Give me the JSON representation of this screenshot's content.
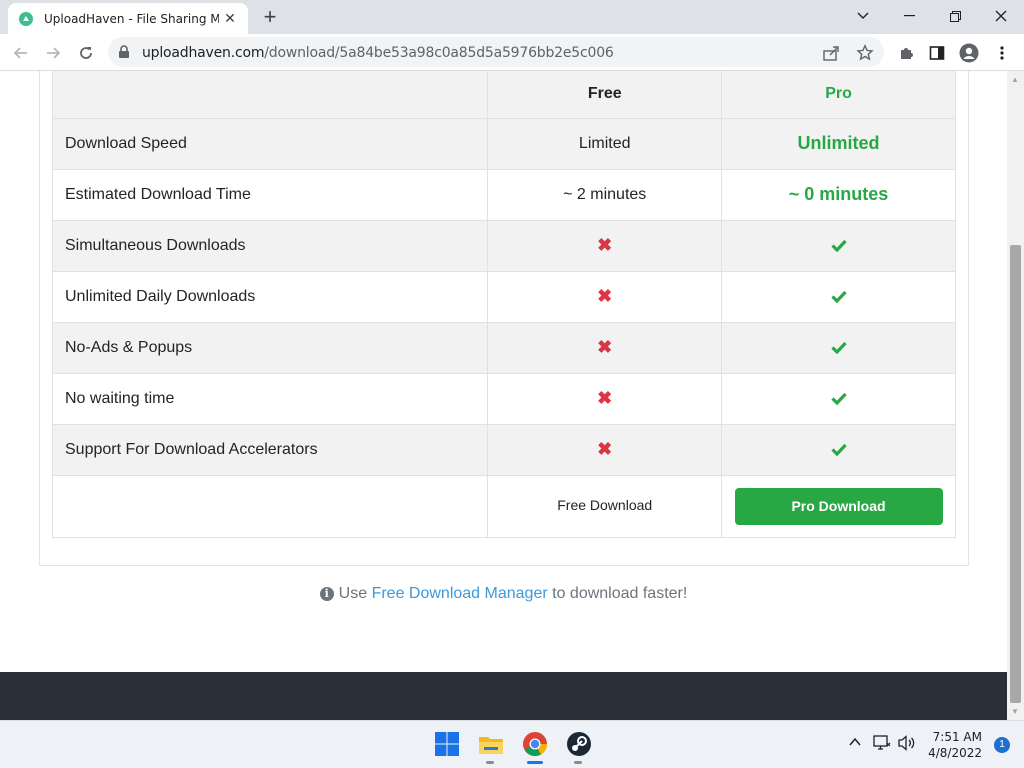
{
  "browser": {
    "tab_title": "UploadHaven - File Sharing Made Simple",
    "url_host": "uploadhaven.com",
    "url_path": "/download/5a84be53a98c0a85d5a5976bb2e5c006"
  },
  "table": {
    "headers": {
      "free": "Free",
      "pro": "Pro"
    },
    "rows": [
      {
        "feature": "Download Speed",
        "free": "Limited",
        "pro": "Unlimited",
        "type": "text"
      },
      {
        "feature": "Estimated Download Time",
        "free": "~ 2 minutes",
        "pro": "~ 0 minutes",
        "type": "text"
      },
      {
        "feature": "Simultaneous Downloads",
        "free": "✖",
        "pro": "✔",
        "type": "icon"
      },
      {
        "feature": "Unlimited Daily Downloads",
        "free": "✖",
        "pro": "✔",
        "type": "icon"
      },
      {
        "feature": "No-Ads & Popups",
        "free": "✖",
        "pro": "✔",
        "type": "icon"
      },
      {
        "feature": "No waiting time",
        "free": "✖",
        "pro": "✔",
        "type": "icon"
      },
      {
        "feature": "Support For Download Accelerators",
        "free": "✖",
        "pro": "✔",
        "type": "icon"
      }
    ],
    "free_download_label": "Free Download",
    "pro_download_label": "Pro Download"
  },
  "tip": {
    "prefix": "Use",
    "link": "Free Download Manager",
    "suffix": "to download faster!"
  },
  "taskbar": {
    "time": "7:51 AM",
    "date": "4/8/2022",
    "notifications": "1"
  },
  "colors": {
    "accent_green": "#28a745",
    "cross_red": "#dc3545",
    "footer": "#2b2f3a",
    "link": "#3b9ad9"
  }
}
